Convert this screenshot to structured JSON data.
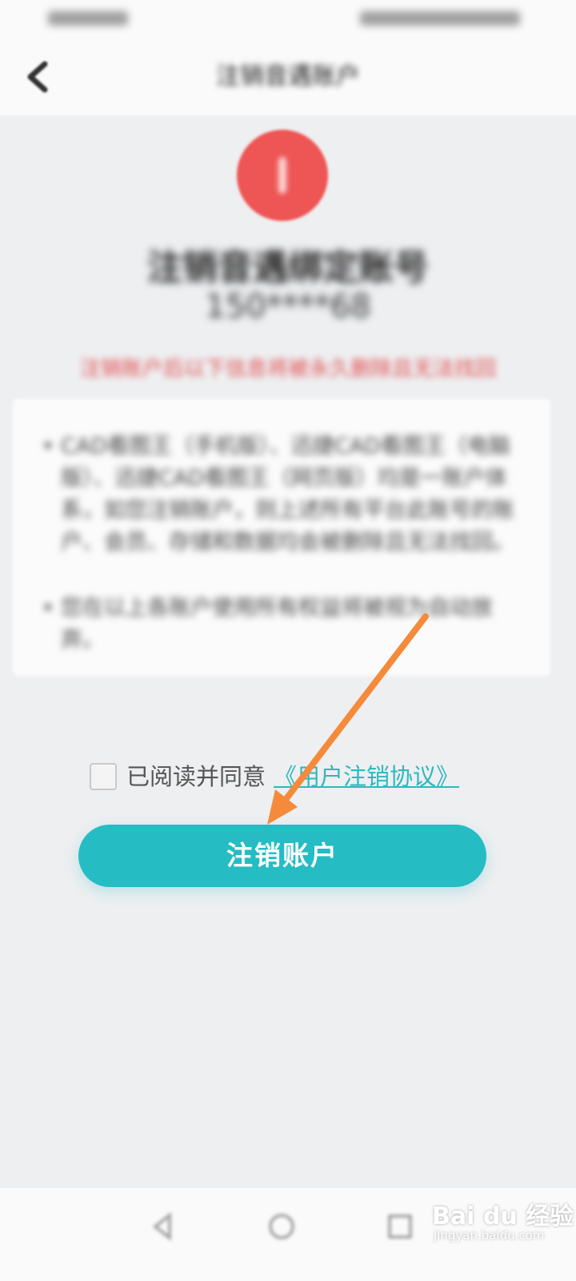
{
  "status_bar": {},
  "header": {
    "title": "注销音遇账户"
  },
  "account": {
    "title": "注销音遇绑定账号",
    "number": "150****68"
  },
  "warning": "注销账户后以下信息将被永久删除且无法找回",
  "info_items": [
    "CAD看图王（手机版）、迅捷CAD看图王（电脑版）、迅捷CAD看图王（网页版）均是一账户体系，如您注销账户，则上述所有平台此账号的账户、会员、存储和数据均会被删除且无法找回。",
    "您在以上各账户使用所有权益将被视为自动放弃。"
  ],
  "agree": {
    "label": "已阅读并同意",
    "link": "《用户注销协议》"
  },
  "primary_button": "注销账户",
  "annotation": {
    "arrow_color": "#f58a3a"
  },
  "watermark": {
    "brand": "Bai du 经验",
    "url": "jingyan.baidu.com"
  }
}
